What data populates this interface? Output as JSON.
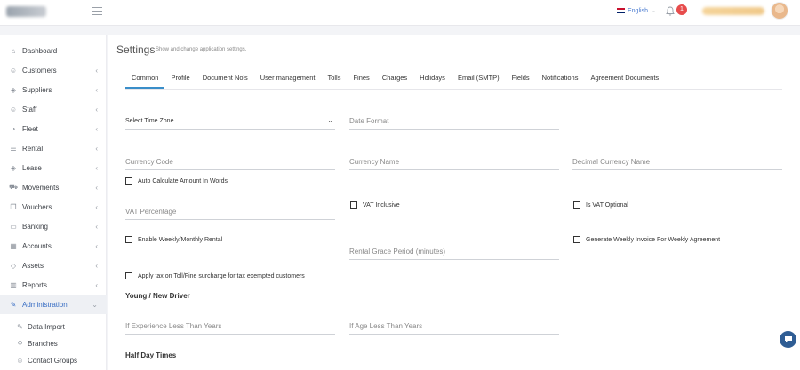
{
  "topbar": {
    "language": "English",
    "notification_count": "1"
  },
  "sidebar": {
    "items": [
      {
        "label": "Dashboard",
        "icon": "home-icon"
      },
      {
        "label": "Customers",
        "icon": "users-icon"
      },
      {
        "label": "Suppliers",
        "icon": "layers-icon"
      },
      {
        "label": "Staff",
        "icon": "user-icon"
      },
      {
        "label": "Fleet",
        "icon": "gauge-icon"
      },
      {
        "label": "Rental",
        "icon": "list-icon"
      },
      {
        "label": "Lease",
        "icon": "stack-icon"
      },
      {
        "label": "Movements",
        "icon": "truck-icon"
      },
      {
        "label": "Vouchers",
        "icon": "copy-icon"
      },
      {
        "label": "Banking",
        "icon": "folder-icon"
      },
      {
        "label": "Accounts",
        "icon": "calculator-icon"
      },
      {
        "label": "Assets",
        "icon": "diamond-icon"
      },
      {
        "label": "Reports",
        "icon": "chart-icon"
      },
      {
        "label": "Administration",
        "icon": "wrench-icon"
      }
    ],
    "sub_items": [
      {
        "label": "Data Import",
        "icon": "wrench-icon"
      },
      {
        "label": "Branches",
        "icon": "map-pin-icon"
      },
      {
        "label": "Contact Groups",
        "icon": "users-icon"
      }
    ]
  },
  "page": {
    "title": "Settings",
    "subtitle": "Show and change application settings."
  },
  "tabs": [
    "Common",
    "Profile",
    "Document No's",
    "User management",
    "Tolls",
    "Fines",
    "Charges",
    "Holidays",
    "Email (SMTP)",
    "Fields",
    "Notifications",
    "Agreement Documents"
  ],
  "form": {
    "time_zone": "Select Time Zone",
    "date_format": "Date Format",
    "currency_code": "Currency Code",
    "currency_name": "Currency Name",
    "decimal_currency_name": "Decimal Currency Name",
    "auto_calc_words": "Auto Calculate Amount In Words",
    "vat_percentage": "VAT Percentage",
    "vat_inclusive": "VAT Inclusive",
    "is_vat_optional": "Is VAT Optional",
    "enable_weekly_monthly": "Enable Weekly/Monthly Rental",
    "generate_weekly_invoice": "Generate Weekly Invoice For Weekly Agreement",
    "rental_grace_period": "Rental Grace Period (minutes)",
    "apply_tax_toll": "Apply tax on Toll/Fine surcharge for tax exempted customers",
    "section_young_driver": "Young / New Driver",
    "experience_less_than": "If Experience Less Than Years",
    "age_less_than": "If Age Less Than Years",
    "section_half_day": "Half Day Times"
  }
}
